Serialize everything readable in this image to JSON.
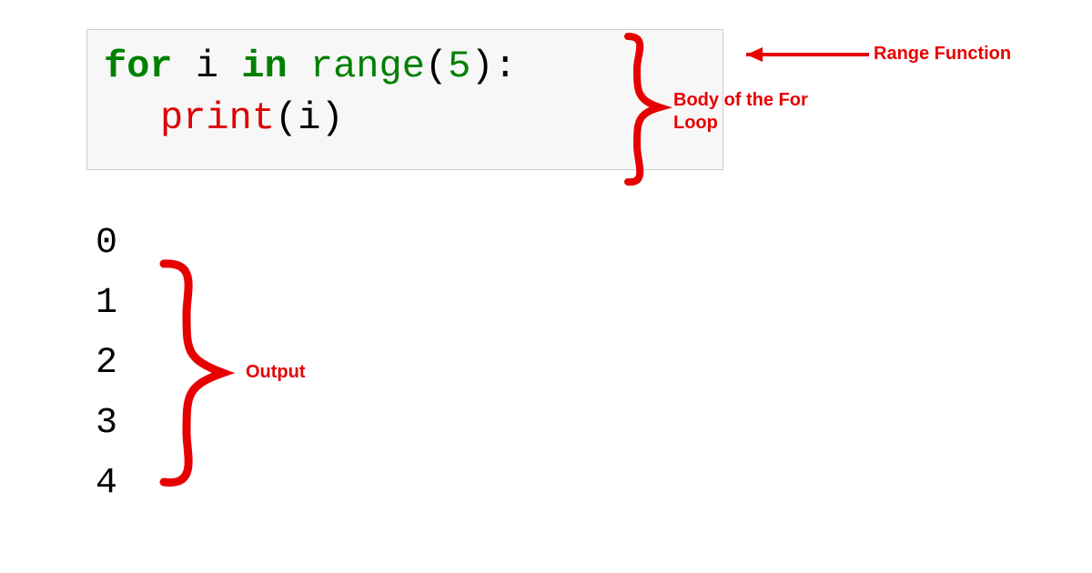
{
  "code": {
    "line1": {
      "kw1": "for",
      "var": " i ",
      "kw2": "in",
      "space": " ",
      "func": "range",
      "lparen": "(",
      "arg": "5",
      "rparen": ")",
      "colon": ":"
    },
    "line2": {
      "func": "print",
      "lparen": "(",
      "arg": "i",
      "rparen": ")"
    }
  },
  "output": [
    "0",
    "1",
    "2",
    "3",
    "4"
  ],
  "annotations": {
    "range_function": "Range Function",
    "body_of_loop": "Body of the For Loop",
    "output": "Output"
  },
  "colors": {
    "annotation": "#e60000",
    "keyword": "#008000",
    "print": "#dd0000",
    "codebg": "#f7f7f7"
  }
}
